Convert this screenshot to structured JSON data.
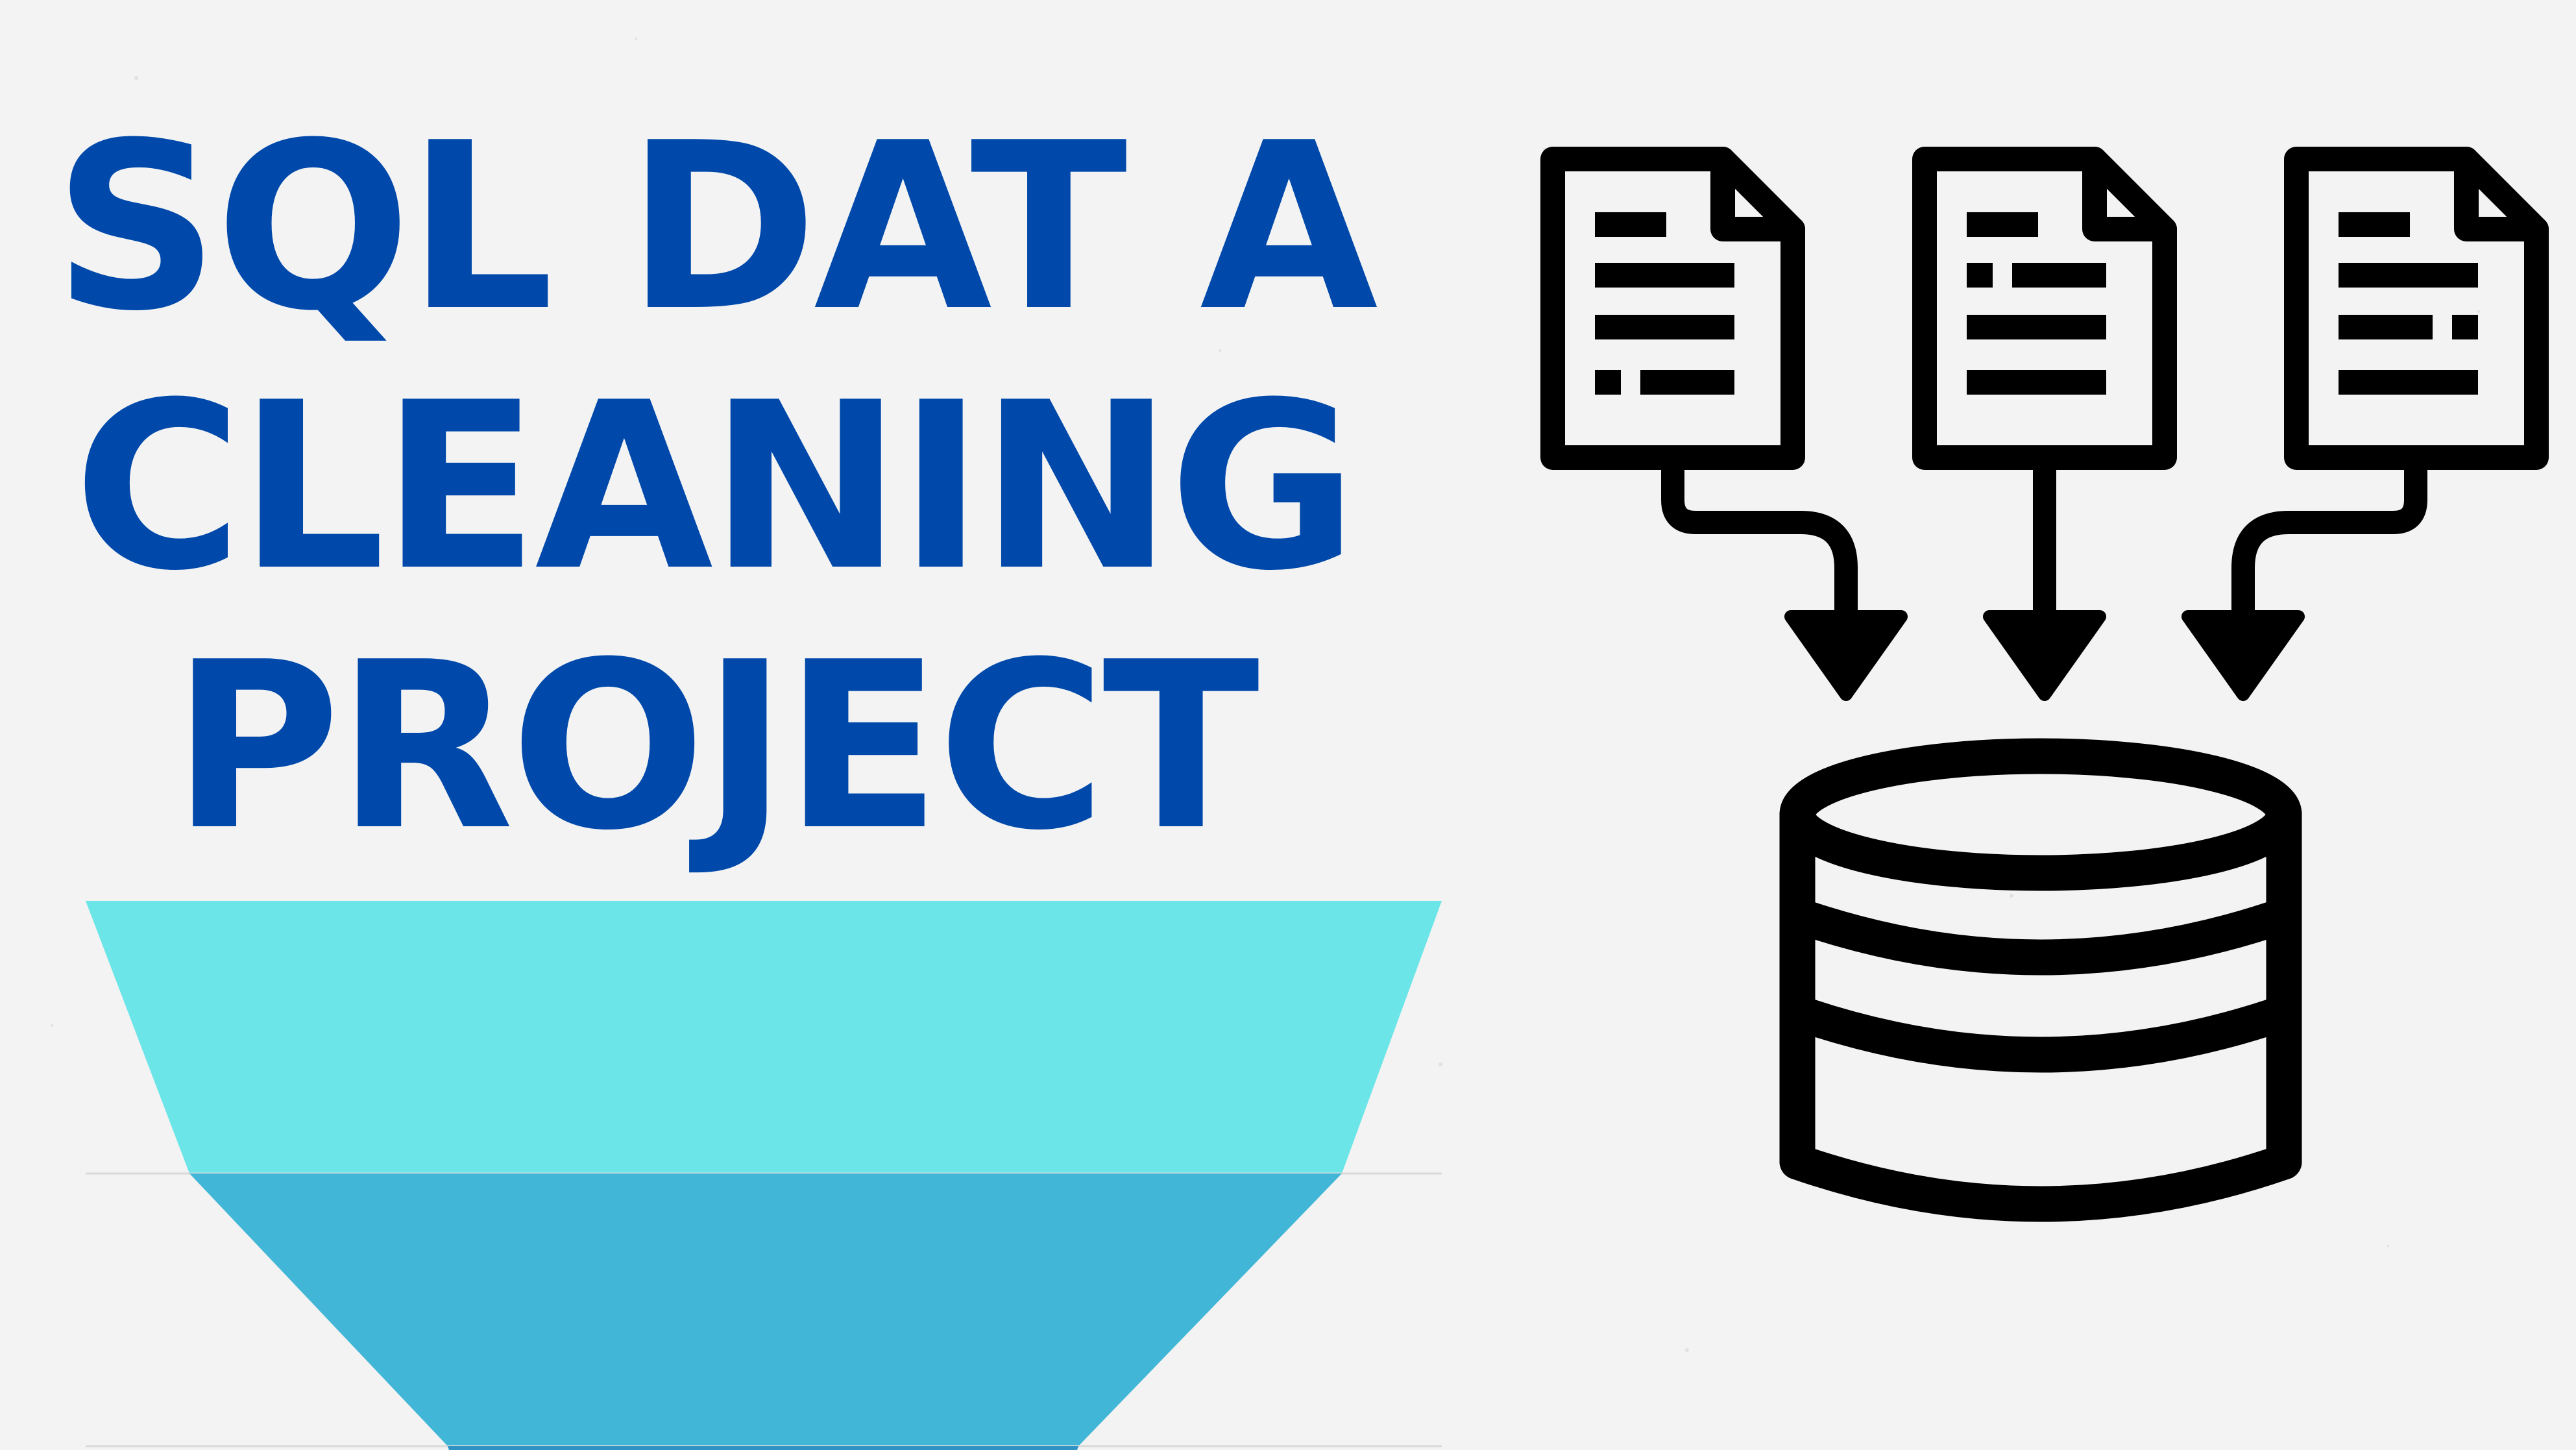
{
  "title": {
    "line1": "SQL DAT A",
    "line2": "CLEANING",
    "line3": "PROJECT"
  },
  "colors": {
    "background": "#f3f3f3",
    "title": "#0049ab",
    "funnel_top": "#6ce5e8",
    "funnel_middle": "#41b6d6",
    "funnel_bottom": "#2f93c4",
    "icon_stroke": "#000000"
  },
  "icons": {
    "documents": [
      "document-icon",
      "document-icon",
      "document-icon"
    ],
    "flow": "arrows-down-icon",
    "database": "database-icon",
    "funnel": "funnel-icon"
  }
}
